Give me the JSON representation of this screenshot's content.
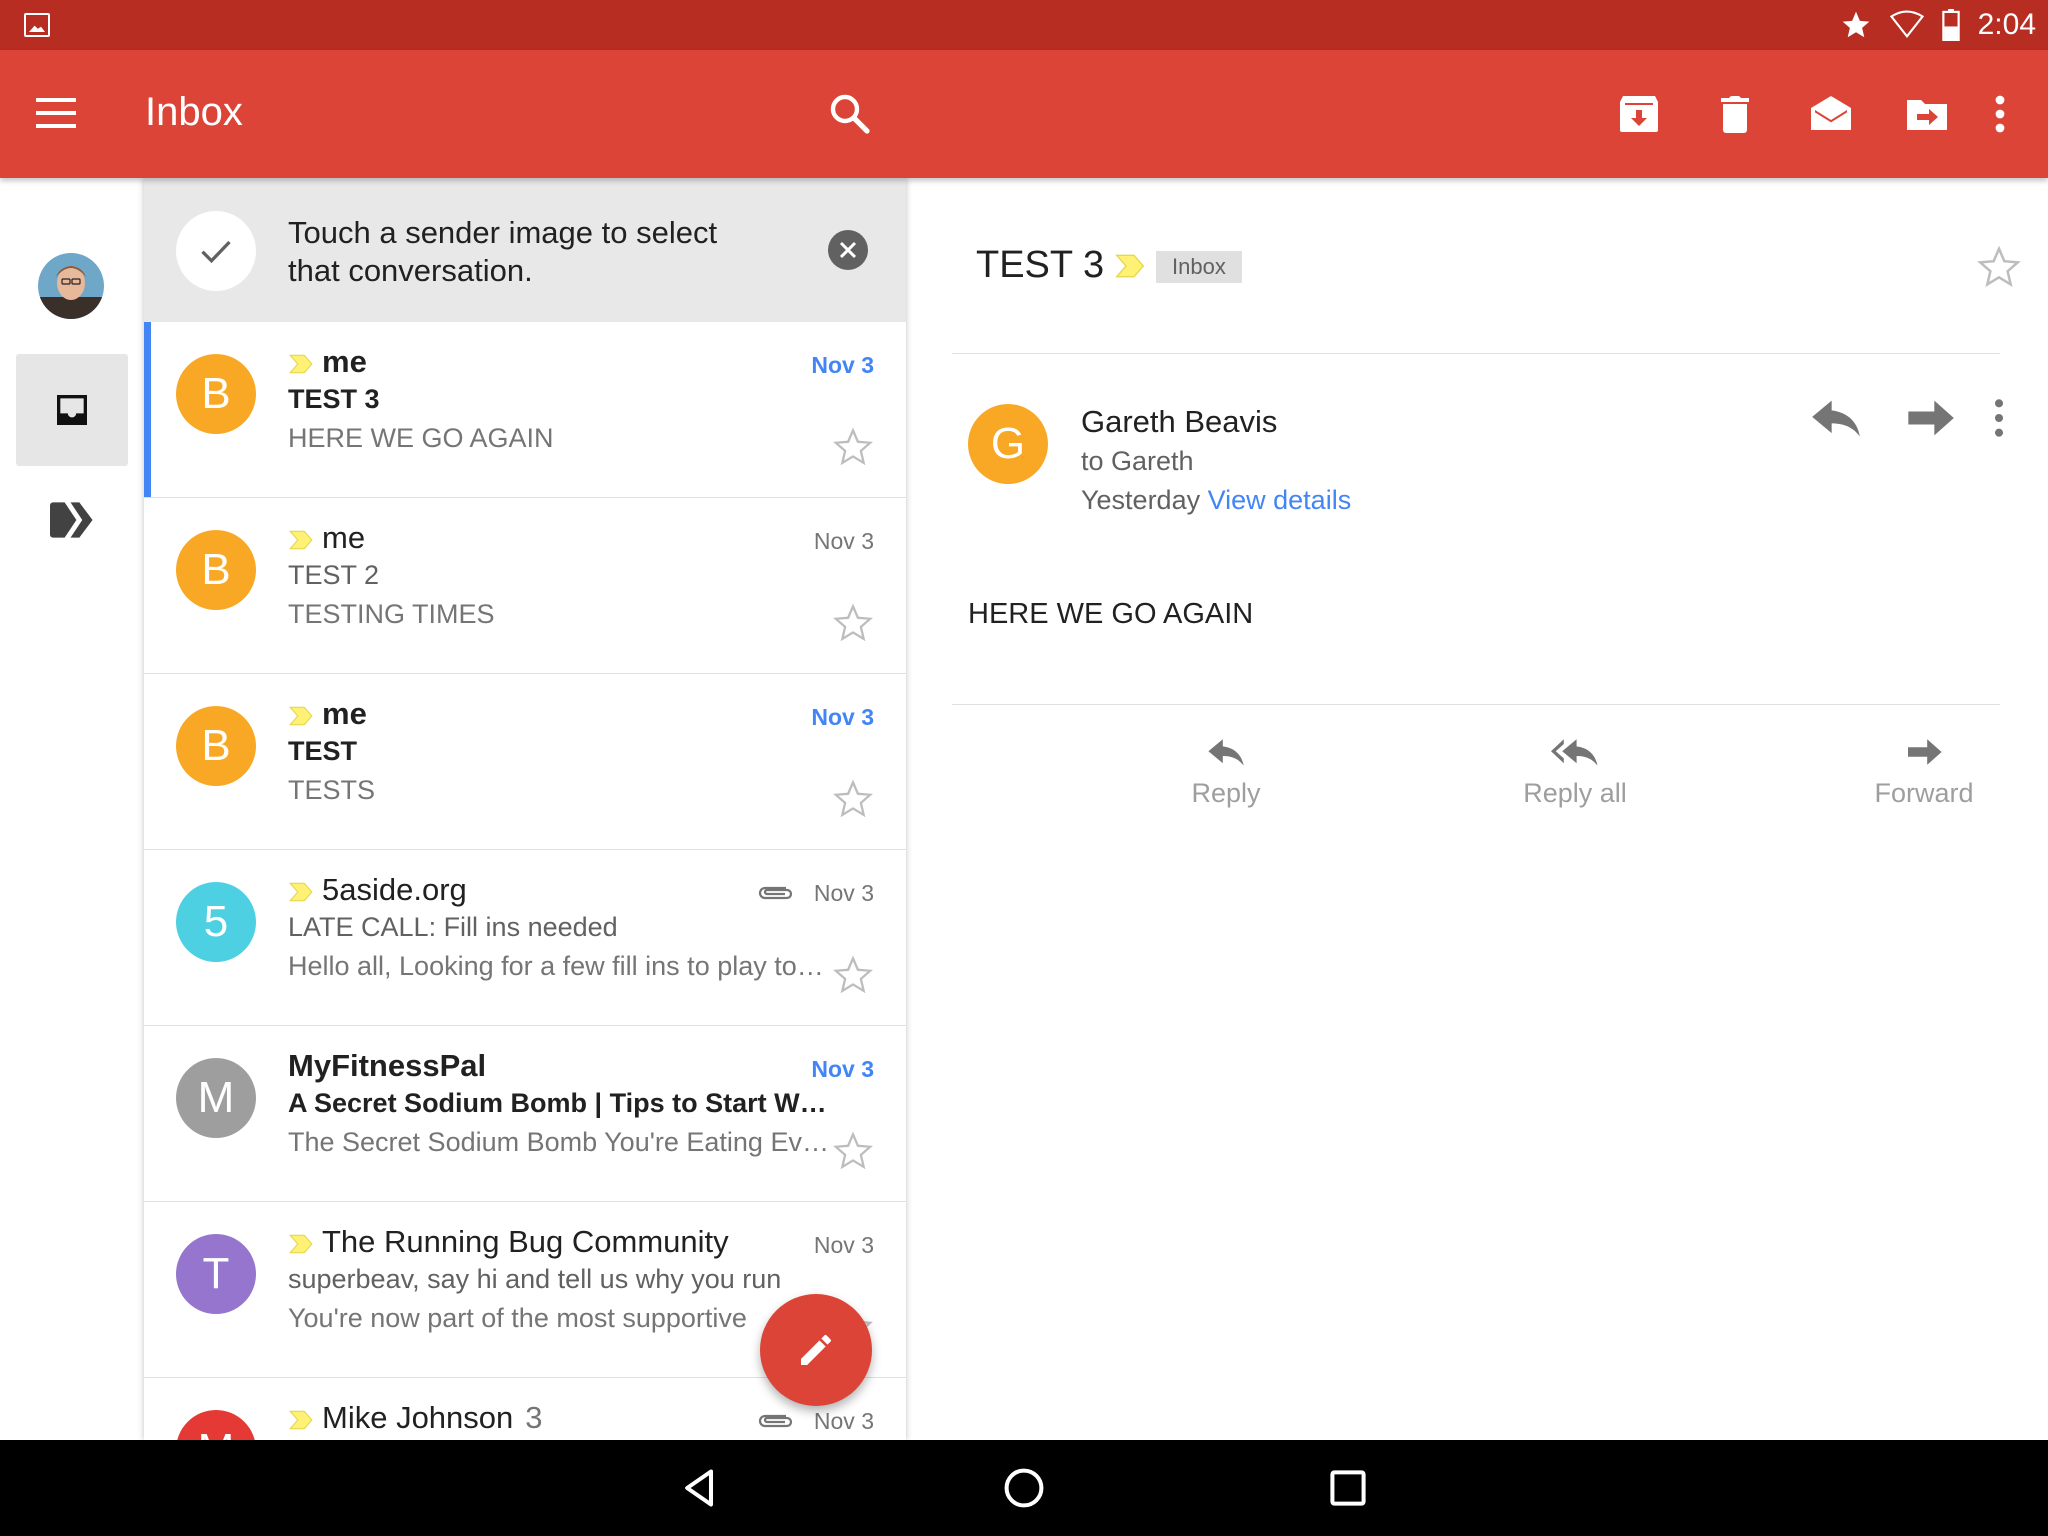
{
  "status_bar": {
    "time": "2:04",
    "icons": [
      "gallery-icon",
      "star-icon",
      "wifi-icon",
      "battery-icon"
    ]
  },
  "toolbar": {
    "title": "Inbox",
    "icons": [
      "menu-icon",
      "search-icon",
      "archive-icon",
      "delete-icon",
      "mark-read-icon",
      "move-to-icon",
      "more-vert-icon"
    ]
  },
  "rail": {
    "items": [
      "account-avatar",
      "inbox-icon",
      "priority-icon"
    ]
  },
  "tip": {
    "text": "Touch a sender image to select that conversation."
  },
  "conversations": [
    {
      "initial": "B",
      "sender": "me",
      "subject": "TEST 3",
      "snippet": "HERE WE GO AGAIN",
      "date": "Nov 3",
      "unread": true,
      "important": true,
      "attachment": false,
      "color": "#f9a825"
    },
    {
      "initial": "B",
      "sender": "me",
      "subject": "TEST 2",
      "snippet": "TESTING TIMES",
      "date": "Nov 3",
      "unread": false,
      "important": true,
      "attachment": false,
      "color": "#f9a825"
    },
    {
      "initial": "B",
      "sender": "me",
      "subject": "TEST",
      "snippet": "TESTS",
      "date": "Nov 3",
      "unread": true,
      "important": true,
      "attachment": false,
      "color": "#f9a825"
    },
    {
      "initial": "5",
      "sender": "5aside.org",
      "subject": "LATE CALL: Fill ins needed",
      "snippet": "Hello all, Looking for a few fill ins to play to…",
      "date": "Nov 3",
      "unread": false,
      "important": true,
      "attachment": true,
      "color": "#4dd0e1"
    },
    {
      "initial": "M",
      "sender": "MyFitnessPal",
      "subject": "A Secret Sodium Bomb | Tips to Start W…",
      "snippet": "The Secret Sodium Bomb You're Eating Ev…",
      "date": "Nov 3",
      "unread": true,
      "important": false,
      "attachment": false,
      "color": "#9e9e9e"
    },
    {
      "initial": "T",
      "sender": "The Running Bug Community",
      "subject": "superbeav, say hi and tell us why you run",
      "snippet": "You're now part of the most supportive",
      "date": "Nov 3",
      "unread": false,
      "important": true,
      "attachment": false,
      "color": "#9575cd"
    },
    {
      "initial": "M",
      "sender": "Mike Johnson",
      "count": "3",
      "subject": "",
      "snippet": "",
      "date": "Nov 3",
      "unread": false,
      "important": true,
      "attachment": true,
      "color": "#e53935"
    }
  ],
  "fab": {
    "icon": "compose-icon"
  },
  "reading_pane": {
    "subject": "TEST 3",
    "label": "Inbox",
    "from_initial": "G",
    "from_name": "Gareth Beavis",
    "to": "to Gareth",
    "time": "Yesterday",
    "details_link": "View details",
    "body": "HERE WE GO AGAIN",
    "actions": {
      "reply": "Reply",
      "reply_all": "Reply all",
      "forward": "Forward"
    }
  },
  "colors": {
    "status_bar": "#b72d22",
    "toolbar": "#db4437",
    "accent_blue": "#4285f4",
    "important_yellow": "#fff176"
  }
}
